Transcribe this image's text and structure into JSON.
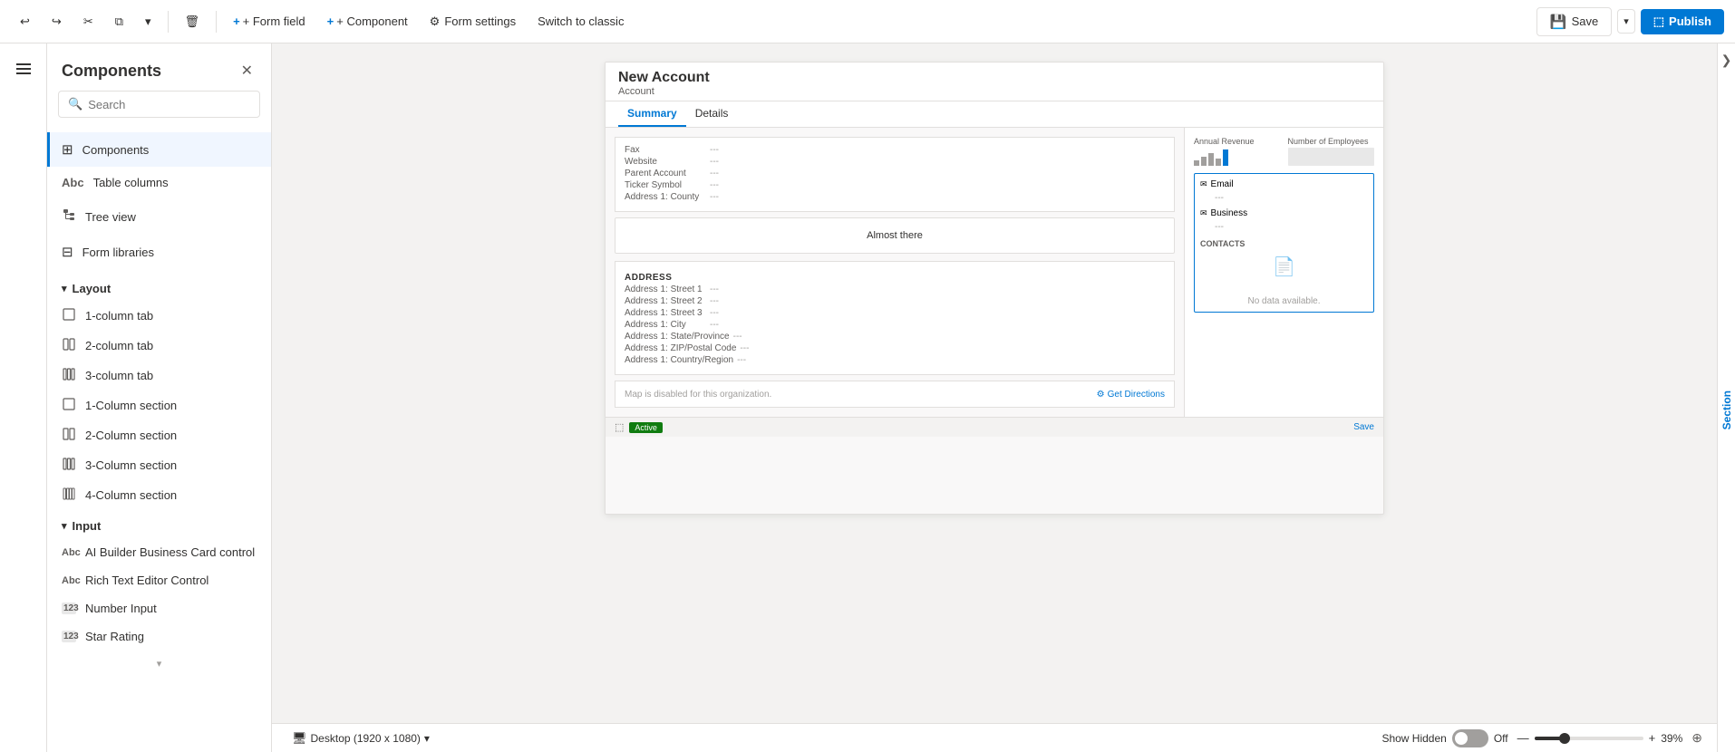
{
  "toolbar": {
    "undo_label": "Undo",
    "redo_label": "Redo",
    "cut_label": "Cut",
    "copy_label": "Copy",
    "more_label": "More",
    "delete_label": "Delete",
    "form_field_label": "+ Form field",
    "component_label": "+ Component",
    "form_settings_label": "Form settings",
    "switch_classic_label": "Switch to classic",
    "save_label": "Save",
    "publish_label": "Publish"
  },
  "panel": {
    "title": "Components",
    "search_placeholder": "Search",
    "close_label": "Close"
  },
  "nav": {
    "items": [
      {
        "id": "components",
        "label": "Components",
        "icon": "⊞"
      },
      {
        "id": "table-columns",
        "label": "Table columns",
        "icon": "Abc"
      },
      {
        "id": "tree-view",
        "label": "Tree view",
        "icon": "🌳"
      },
      {
        "id": "form-libraries",
        "label": "Form libraries",
        "icon": "⊟"
      }
    ]
  },
  "sections": {
    "layout": {
      "label": "Layout",
      "items": [
        {
          "id": "1-column-tab",
          "label": "1-column tab",
          "icon": "▭"
        },
        {
          "id": "2-column-tab",
          "label": "2-column tab",
          "icon": "⊞"
        },
        {
          "id": "3-column-tab",
          "label": "3-column tab",
          "icon": "⊟"
        },
        {
          "id": "1-column-section",
          "label": "1-Column section",
          "icon": "▭"
        },
        {
          "id": "2-column-section",
          "label": "2-Column section",
          "icon": "⊞"
        },
        {
          "id": "3-column-section",
          "label": "3-Column section",
          "icon": "⊟"
        },
        {
          "id": "4-column-section",
          "label": "4-Column section",
          "icon": "⊟"
        }
      ]
    },
    "input": {
      "label": "Input",
      "items": [
        {
          "id": "ai-builder",
          "label": "AI Builder Business Card control",
          "icon": "Abc"
        },
        {
          "id": "rich-text",
          "label": "Rich Text Editor Control",
          "icon": "Abc"
        },
        {
          "id": "number-input",
          "label": "Number Input",
          "icon": "123"
        },
        {
          "id": "star-rating",
          "label": "Star Rating",
          "icon": "123"
        }
      ]
    }
  },
  "form_preview": {
    "title": "New Account",
    "subtitle": "Account",
    "tabs": [
      "Summary",
      "Details"
    ],
    "active_tab": "Summary",
    "fields_top": [
      {
        "label": "Fax",
        "value": "---"
      },
      {
        "label": "Website",
        "value": "---"
      },
      {
        "label": "Parent Account",
        "value": "---"
      },
      {
        "label": "Ticker Symbol",
        "value": "---"
      },
      {
        "label": "Address 1: County",
        "value": "---"
      }
    ],
    "almost_there": "Almost there",
    "address_section": {
      "title": "ADDRESS",
      "fields": [
        {
          "label": "Address 1: Street 1",
          "value": "---"
        },
        {
          "label": "Address 1: Street 2",
          "value": "---"
        },
        {
          "label": "Address 1: Street 3",
          "value": "---"
        },
        {
          "label": "Address 1: City",
          "value": "---"
        },
        {
          "label": "Address 1: State/Province",
          "value": "---"
        },
        {
          "label": "Address 1: ZIP/Postal Code",
          "value": "---"
        },
        {
          "label": "Address 1: Country/Region",
          "value": "---"
        }
      ]
    },
    "map_disabled": "Map is disabled for this organization.",
    "get_directions": "Get Directions",
    "status_badge": "Active",
    "save_btn": "Save",
    "side_panel": {
      "annual_revenue": "Annual Revenue",
      "num_employees": "Number of Employees",
      "email_label": "Email",
      "email_value": "---",
      "business_label": "Business",
      "business_value": "---",
      "contacts_label": "CONTACTS",
      "no_data": "No data available."
    }
  },
  "status_bar": {
    "desktop_label": "Desktop (1920 x 1080)",
    "show_hidden_label": "Show Hidden",
    "toggle_state": "Off",
    "zoom_level": "39%",
    "fit_icon": "⊕"
  }
}
